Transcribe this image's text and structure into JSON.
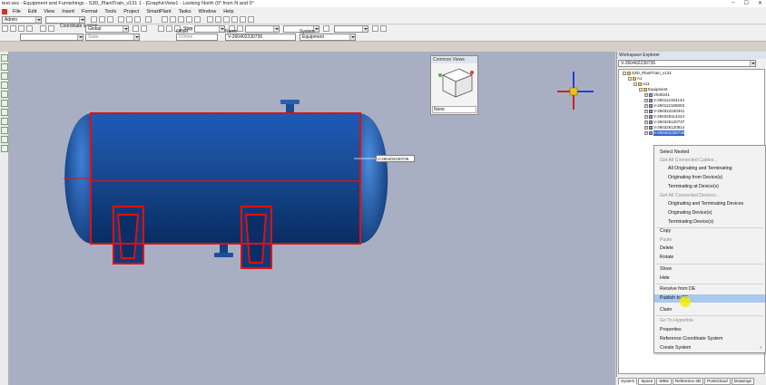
{
  "title_bar": {
    "title": "test.ses - Equipment and Furnishings - S3D_PlantTrain_v131 1 - [GraphicView1 - Looking North (0° from N and 0°",
    "controls": [
      "–",
      "☐",
      "✕"
    ]
  },
  "menu": [
    "File",
    "Edit",
    "View",
    "Insert",
    "Format",
    "Tools",
    "Project",
    "SmartPlant",
    "Tasks",
    "Window",
    "Help"
  ],
  "toolbar": {
    "permission_group": "Admin",
    "coordinate_system_label": "Coordinate system",
    "coordinate_system_value": "Global",
    "step_label": "Step",
    "offset_label": "Offset",
    "offset_value": "0.0mm",
    "name_label": "Name",
    "name_value": "V-260402230736",
    "system_label": "System",
    "system_value": "Equipment",
    "state_value": "State"
  },
  "common_views": {
    "title": "Common Views",
    "value": "None"
  },
  "viewport": {
    "background_color": "#a9afc2",
    "tag_label": "V-260402230736",
    "vessel_color": "#1f5fa8",
    "highlight_color": "#e01010"
  },
  "workspace_explorer": {
    "title": "Workspace Explorer",
    "filter_value": "V-260402230736",
    "tree": [
      {
        "label": "S3D_PlantTrain_v131",
        "level": 0,
        "expander": "-",
        "icon": "folder"
      },
      {
        "label": "A1",
        "level": 1,
        "expander": "-",
        "icon": "folder"
      },
      {
        "label": "U11",
        "level": 2,
        "expander": "-",
        "icon": "folder"
      },
      {
        "label": "Equipment",
        "level": 3,
        "expander": "-",
        "icon": "folder"
      },
      {
        "label": "V040241",
        "level": 4,
        "expander": "+",
        "icon": "equipment"
      },
      {
        "label": "V-260112184144",
        "level": 4,
        "expander": "+",
        "icon": "equipment"
      },
      {
        "label": "V-260112185003",
        "level": 4,
        "expander": "+",
        "icon": "equipment"
      },
      {
        "label": "V-260324100341",
        "level": 4,
        "expander": "+",
        "icon": "equipment"
      },
      {
        "label": "V-260325114224",
        "level": 4,
        "expander": "+",
        "icon": "equipment"
      },
      {
        "label": "V-260326120737",
        "level": 4,
        "expander": "+",
        "icon": "equipment"
      },
      {
        "label": "V-260326120814",
        "level": 4,
        "expander": "+",
        "icon": "equipment"
      },
      {
        "label": "V-260402230736",
        "level": 4,
        "expander": "+",
        "icon": "equipment",
        "selected": true
      }
    ],
    "tabs": [
      "System",
      "Space",
      "WBS",
      "Reference 3D",
      "PointCloud",
      "Drawings"
    ]
  },
  "context_menu": {
    "items": [
      {
        "label": "Select Nested",
        "disabled": false,
        "indent": false
      },
      {
        "label": "Get All Connected Cables...",
        "disabled": true,
        "indent": false
      },
      {
        "label": "All Originating and Terminating",
        "disabled": false,
        "indent": true
      },
      {
        "label": "Originating from Device(s)",
        "disabled": false,
        "indent": true
      },
      {
        "label": "Terminating at Device(s)",
        "disabled": false,
        "indent": true
      },
      {
        "label": "Get All Connected Devices...",
        "disabled": true,
        "indent": false
      },
      {
        "label": "Originating and Terminating Devices",
        "disabled": false,
        "indent": true
      },
      {
        "label": "Originating Device(s)",
        "disabled": false,
        "indent": true
      },
      {
        "label": "Terminating Device(s)",
        "disabled": false,
        "indent": true
      },
      {
        "label": "Copy",
        "disabled": false,
        "indent": false
      },
      {
        "label": "Paste",
        "disabled": true,
        "indent": false
      },
      {
        "label": "Delete",
        "disabled": false,
        "indent": false
      },
      {
        "label": "Rotate",
        "disabled": false,
        "indent": false
      },
      {
        "label": "Show",
        "disabled": false,
        "indent": false
      },
      {
        "label": "Hide",
        "disabled": false,
        "indent": false
      },
      {
        "label": "Receive from DE",
        "disabled": false,
        "indent": false
      },
      {
        "label": "Publish to DE",
        "disabled": false,
        "indent": false,
        "highlighted": true
      },
      {
        "label": "Claim",
        "disabled": false,
        "indent": false
      },
      {
        "label": "Go To Hyperlink",
        "disabled": true,
        "indent": false
      },
      {
        "label": "Properties",
        "disabled": false,
        "indent": false
      },
      {
        "label": "Reference Coordinate System",
        "disabled": false,
        "indent": false
      },
      {
        "label": "Create System",
        "disabled": false,
        "indent": false,
        "submenu": true
      }
    ]
  }
}
